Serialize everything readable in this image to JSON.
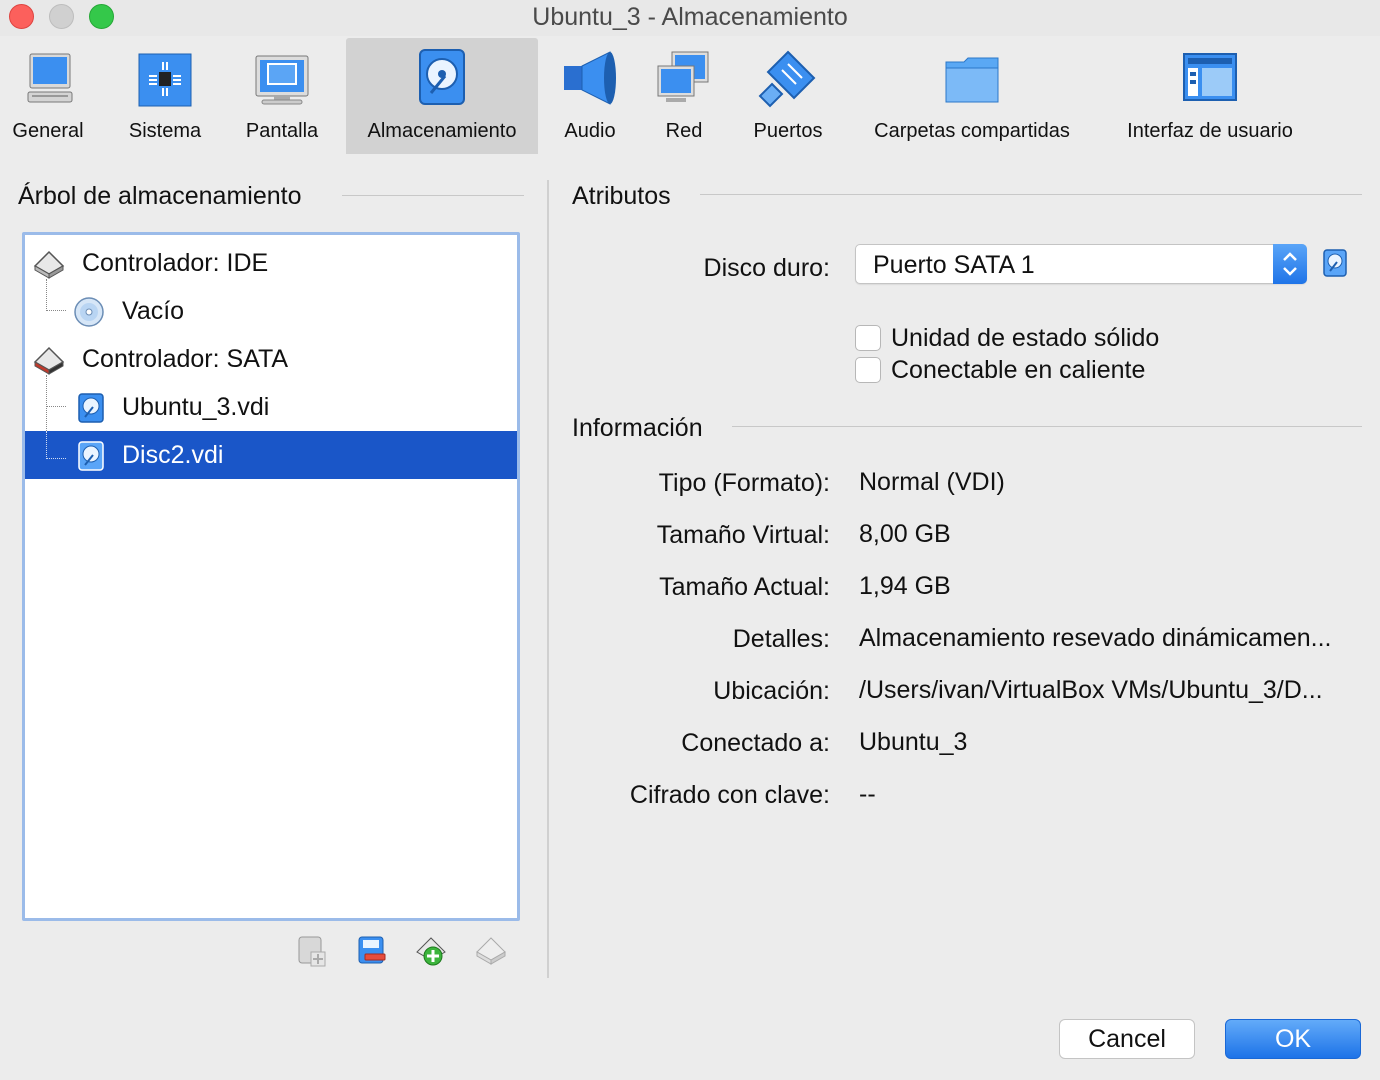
{
  "window": {
    "title": "Ubuntu_3 - Almacenamiento"
  },
  "toolbar": {
    "items": [
      {
        "label": "General",
        "icon": "monitor-general-icon"
      },
      {
        "label": "Sistema",
        "icon": "chip-icon"
      },
      {
        "label": "Pantalla",
        "icon": "display-icon"
      },
      {
        "label": "Almacenamiento",
        "icon": "hard-disk-icon",
        "selected": true
      },
      {
        "label": "Audio",
        "icon": "speaker-icon"
      },
      {
        "label": "Red",
        "icon": "network-icon"
      },
      {
        "label": "Puertos",
        "icon": "usb-port-icon"
      },
      {
        "label": "Carpetas compartidas",
        "icon": "folder-icon"
      },
      {
        "label": "Interfaz de usuario",
        "icon": "user-interface-icon"
      }
    ]
  },
  "storage_tree": {
    "title": "Árbol de almacenamiento",
    "items": [
      {
        "label": "Controlador: IDE",
        "icon": "ide-controller-icon",
        "level": 0
      },
      {
        "label": "Vacío",
        "icon": "optical-disc-icon",
        "level": 1
      },
      {
        "label": "Controlador: SATA",
        "icon": "sata-controller-icon",
        "level": 0
      },
      {
        "label": "Ubuntu_3.vdi",
        "icon": "hard-disk-icon",
        "level": 1
      },
      {
        "label": "Disc2.vdi",
        "icon": "hard-disk-icon",
        "level": 1,
        "selected": true
      }
    ],
    "tools": [
      "add-attachment-icon",
      "remove-attachment-icon",
      "add-controller-icon",
      "remove-controller-icon"
    ]
  },
  "attributes": {
    "title": "Atributos",
    "hard_disk_label": "Disco duro:",
    "hard_disk_value": "Puerto SATA 1",
    "ssd_label": "Unidad de estado sólido",
    "hotplug_label": "Conectable en caliente"
  },
  "information": {
    "title": "Información",
    "rows": [
      {
        "label": "Tipo (Formato):",
        "value": "Normal (VDI)"
      },
      {
        "label": "Tamaño Virtual:",
        "value": "8,00 GB"
      },
      {
        "label": "Tamaño Actual:",
        "value": "1,94 GB"
      },
      {
        "label": "Detalles:",
        "value": "Almacenamiento resevado dinámicamen..."
      },
      {
        "label": "Ubicación:",
        "value": "/Users/ivan/VirtualBox VMs/Ubuntu_3/D..."
      },
      {
        "label": "Conectado a:",
        "value": "Ubuntu_3"
      },
      {
        "label": "Cifrado con clave:",
        "value": "--"
      }
    ]
  },
  "buttons": {
    "cancel": "Cancel",
    "ok": "OK"
  },
  "colors": {
    "selection": "#1a56c8",
    "accent": "#1d73e8"
  }
}
